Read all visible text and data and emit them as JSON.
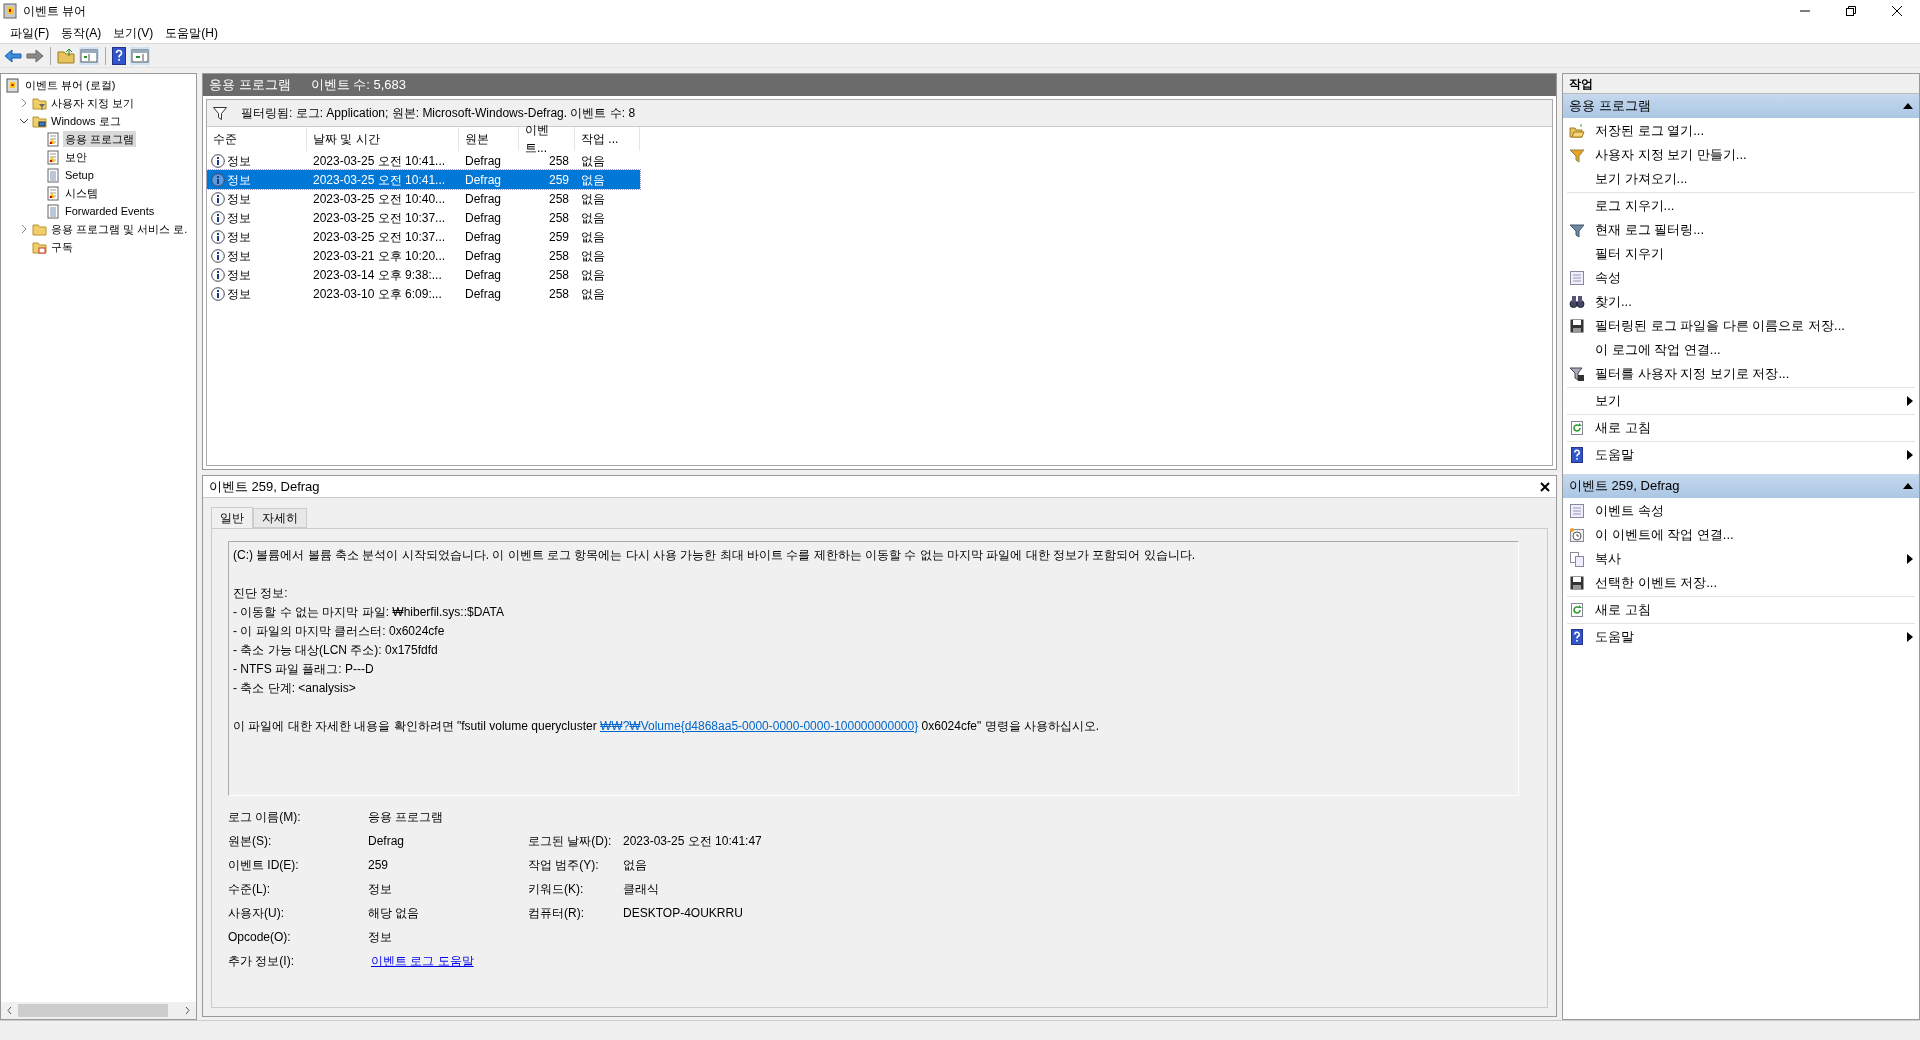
{
  "window": {
    "title": "이벤트 뷰어"
  },
  "menu": [
    "파일(F)",
    "동작(A)",
    "보기(V)",
    "도움말(H)"
  ],
  "tree": [
    {
      "label": "이벤트 뷰어 (로컬)",
      "kind": "viewer",
      "selected": false,
      "children": [
        {
          "label": "사용자 지정 보기",
          "kind": "views",
          "expanded": false,
          "selected": false
        },
        {
          "label": "Windows 로그",
          "kind": "logs",
          "expanded": true,
          "selected": false,
          "children": [
            {
              "label": "응용 프로그램",
              "kind": "alertlog",
              "selected": true
            },
            {
              "label": "보안",
              "kind": "alertlog",
              "selected": false
            },
            {
              "label": "Setup",
              "kind": "log",
              "selected": false
            },
            {
              "label": "시스템",
              "kind": "alertlog",
              "selected": false
            },
            {
              "label": "Forwarded Events",
              "kind": "log",
              "selected": false
            }
          ]
        },
        {
          "label": "응용 프로그램 및 서비스 로.",
          "kind": "folder",
          "expanded": false,
          "selected": false
        },
        {
          "label": "구독",
          "kind": "subscriptions",
          "selected": false
        }
      ]
    }
  ],
  "list_header": {
    "title": "응용 프로그램",
    "count": "이벤트 수: 5,683"
  },
  "filter": "필터링됨: 로그: Application; 원본: Microsoft-Windows-Defrag. 이벤트 수: 8",
  "table": {
    "columns": [
      "수준",
      "날짜 및 시간",
      "원본",
      "이벤트...",
      "작업 ..."
    ],
    "rows": [
      {
        "level": "정보",
        "datetime": "2023-03-25 오전 10:41...",
        "source": "Defrag",
        "event_id": "258",
        "task": "없음",
        "selected": false
      },
      {
        "level": "정보",
        "datetime": "2023-03-25 오전 10:41...",
        "source": "Defrag",
        "event_id": "259",
        "task": "없음",
        "selected": true
      },
      {
        "level": "정보",
        "datetime": "2023-03-25 오전 10:40...",
        "source": "Defrag",
        "event_id": "258",
        "task": "없음",
        "selected": false
      },
      {
        "level": "정보",
        "datetime": "2023-03-25 오전 10:37...",
        "source": "Defrag",
        "event_id": "258",
        "task": "없음",
        "selected": false
      },
      {
        "level": "정보",
        "datetime": "2023-03-25 오전 10:37...",
        "source": "Defrag",
        "event_id": "259",
        "task": "없음",
        "selected": false
      },
      {
        "level": "정보",
        "datetime": "2023-03-21 오후 10:20...",
        "source": "Defrag",
        "event_id": "258",
        "task": "없음",
        "selected": false
      },
      {
        "level": "정보",
        "datetime": "2023-03-14 오후 9:38:...",
        "source": "Defrag",
        "event_id": "258",
        "task": "없음",
        "selected": false
      },
      {
        "level": "정보",
        "datetime": "2023-03-10 오후 6:09:...",
        "source": "Defrag",
        "event_id": "258",
        "task": "없음",
        "selected": false
      }
    ]
  },
  "detail": {
    "title": "이벤트 259, Defrag",
    "tabs": [
      {
        "label": "일반",
        "selected": true
      },
      {
        "label": "자세히",
        "selected": false
      }
    ],
    "message": [
      [
        "(C:) 볼륨에서 볼륨 축소 분석이 시작되었습니다. 이 이벤트 로그 항목에는 다시 사용 가능한 최대 바이트 수를 제한하는 이동할 수 없는 마지막 파일에 대한 정보가 포함되어 있습니다."
      ],
      [
        "진단 정보:",
        "- 이동할 수 없는 마지막 파일: ₩hiberfil.sys::$DATA",
        "- 이 파일의 마지막 클러스터: 0x6024cfe",
        "- 축소 가능 대상(LCN 주소): 0x175fdfd",
        "- NTFS 파일 플래그: P---D",
        "- 축소 단계: <analysis>"
      ]
    ],
    "command": {
      "before": "이 파일에 대한 자세한 내용을 확인하려면 \"fsutil volume querycluster",
      "link": "₩₩?₩Volume{d4868aa5-0000-0000-0000-100000000000}",
      "after": "0x6024cfe\" 명령을 사용하십시오."
    },
    "properties": [
      {
        "left": {
          "label": "로그 이름(M):",
          "value": "응용 프로그램"
        }
      },
      {
        "left": {
          "label": "원본(S):",
          "value": "Defrag"
        },
        "right": {
          "label": "로그된 날짜(D):",
          "value": "2023-03-25 오전 10:41:47"
        }
      },
      {
        "left": {
          "label": "이벤트 ID(E):",
          "value": "259"
        },
        "right": {
          "label": "작업 범주(Y):",
          "value": "없음"
        }
      },
      {
        "left": {
          "label": "수준(L):",
          "value": "정보"
        },
        "right": {
          "label": "키워드(K):",
          "value": "클래식"
        }
      },
      {
        "left": {
          "label": "사용자(U):",
          "value": "해당 없음"
        },
        "right": {
          "label": "컴퓨터(R):",
          "value": "DESKTOP-4OUKRRU"
        }
      },
      {
        "left": {
          "label": "Opcode(O):",
          "value": "정보"
        }
      },
      {
        "left": {
          "label": "추가 정보(I):",
          "value": "이벤트 로그 도움말",
          "kind": "link"
        }
      }
    ]
  },
  "actions": {
    "title": "작업",
    "sections": [
      {
        "title": "응용 프로그램",
        "expanded": true,
        "groups": [
          [
            {
              "label": "저장된 로그 열기...",
              "kind": "open"
            },
            {
              "label": "사용자 지정 보기 만들기...",
              "kind": "newfilter"
            },
            {
              "label": "보기 가져오기...",
              "kind": "plain"
            }
          ],
          [
            {
              "label": "로그 지우기...",
              "kind": "plain"
            },
            {
              "label": "현재 로그 필터링...",
              "kind": "filter"
            },
            {
              "label": "필터 지우기",
              "kind": "plain"
            },
            {
              "label": "속성",
              "kind": "properties"
            },
            {
              "label": "찾기...",
              "kind": "find"
            },
            {
              "label": "필터링된 로그 파일을 다른 이름으로 저장...",
              "kind": "save"
            },
            {
              "label": "이 로그에 작업 연결...",
              "kind": "plain"
            },
            {
              "label": "필터를 사용자 지정 보기로 저장...",
              "kind": "filtersave"
            }
          ],
          [
            {
              "label": "보기",
              "kind": "plain",
              "submenu": true
            }
          ],
          [
            {
              "label": "새로 고침",
              "kind": "refresh"
            }
          ],
          [
            {
              "label": "도움말",
              "kind": "help",
              "submenu": true
            }
          ]
        ]
      },
      {
        "title": "이벤트 259, Defrag",
        "expanded": true,
        "groups": [
          [
            {
              "label": "이벤트 속성",
              "kind": "properties"
            },
            {
              "label": "이 이벤트에 작업 연결...",
              "kind": "task"
            },
            {
              "label": "복사",
              "kind": "copy",
              "submenu": true
            },
            {
              "label": "선택한 이벤트 저장...",
              "kind": "save"
            }
          ],
          [
            {
              "label": "새로 고침",
              "kind": "refresh"
            }
          ],
          [
            {
              "label": "도움말",
              "kind": "help",
              "submenu": true
            }
          ]
        ]
      }
    ]
  }
}
